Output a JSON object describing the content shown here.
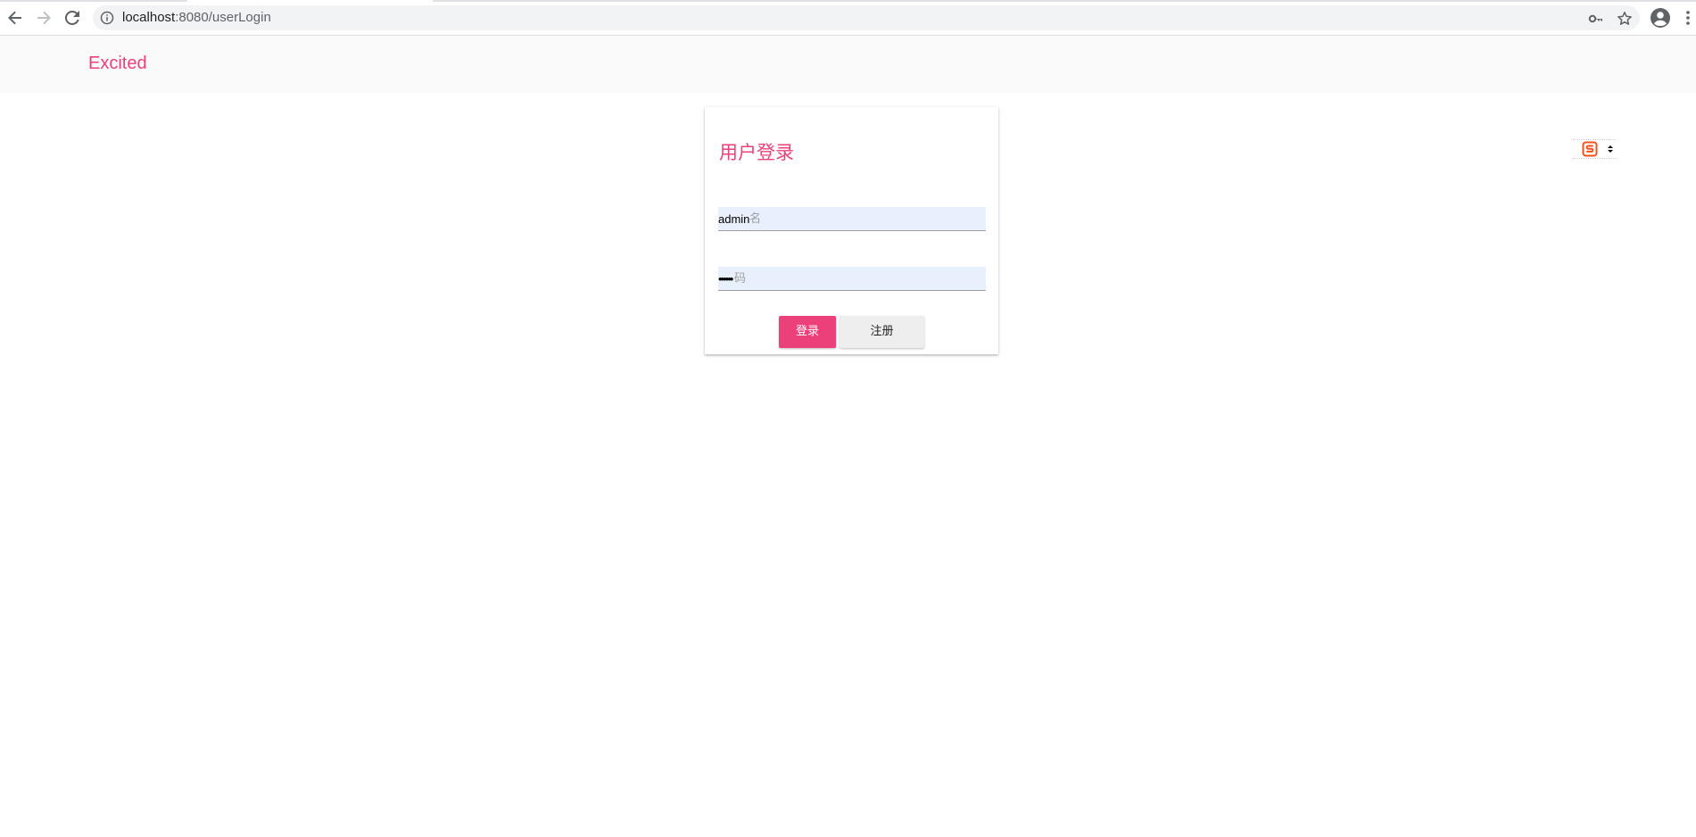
{
  "browser": {
    "url_host": "localhost",
    "url_path": ":8080/userLogin",
    "icons": [
      "back-arrow-icon",
      "forward-arrow-icon",
      "reload-icon",
      "info-icon",
      "key-icon",
      "star-icon",
      "profile-icon",
      "kebab-menu-icon"
    ]
  },
  "header": {
    "brand": "Excited"
  },
  "login": {
    "title": "用户登录",
    "username_value": "admin",
    "username_hint": "名",
    "password_value": "••••••",
    "password_hint": "码",
    "login_label": "登录",
    "register_label": "注册"
  },
  "widget": {
    "icon": "sogou-s-icon",
    "caret": "caret-icon"
  },
  "colors": {
    "accent": "#ec407a",
    "autofill": "#e8f0fe",
    "header_bg": "#fafafa",
    "secondary_button": "#eeeeee"
  }
}
